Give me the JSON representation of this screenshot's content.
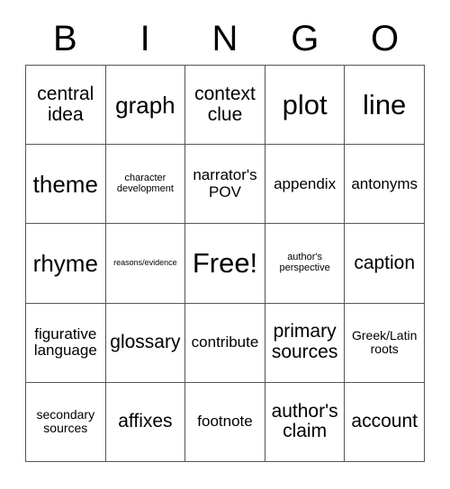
{
  "card": {
    "header_letters": [
      "B",
      "I",
      "N",
      "G",
      "O"
    ],
    "rows": [
      [
        {
          "label": "central idea",
          "size": "md"
        },
        {
          "label": "graph",
          "size": "lg"
        },
        {
          "label": "context clue",
          "size": "md"
        },
        {
          "label": "plot",
          "size": "xl"
        },
        {
          "label": "line",
          "size": "xl"
        }
      ],
      [
        {
          "label": "theme",
          "size": "lg"
        },
        {
          "label": "character development",
          "size": "xxs"
        },
        {
          "label": "narrator's POV",
          "size": "sm"
        },
        {
          "label": "appendix",
          "size": "sm"
        },
        {
          "label": "antonyms",
          "size": "sm"
        }
      ],
      [
        {
          "label": "rhyme",
          "size": "lg"
        },
        {
          "label": "reasons/evidence",
          "size": "tiny"
        },
        {
          "label": "Free!",
          "size": "xl"
        },
        {
          "label": "author's perspective",
          "size": "xxs"
        },
        {
          "label": "caption",
          "size": "md"
        }
      ],
      [
        {
          "label": "figurative language",
          "size": "sm"
        },
        {
          "label": "glossary",
          "size": "md"
        },
        {
          "label": "contribute",
          "size": "sm"
        },
        {
          "label": "primary sources",
          "size": "md"
        },
        {
          "label": "Greek/Latin roots",
          "size": "xs"
        }
      ],
      [
        {
          "label": "secondary sources",
          "size": "xs"
        },
        {
          "label": "affixes",
          "size": "md"
        },
        {
          "label": "footnote",
          "size": "sm"
        },
        {
          "label": "author's claim",
          "size": "md"
        },
        {
          "label": "account",
          "size": "md"
        }
      ]
    ]
  },
  "colors": {
    "border": "#555555",
    "cell_background": "#ffffff",
    "text": "#000000",
    "page_background": "#ffffff"
  }
}
